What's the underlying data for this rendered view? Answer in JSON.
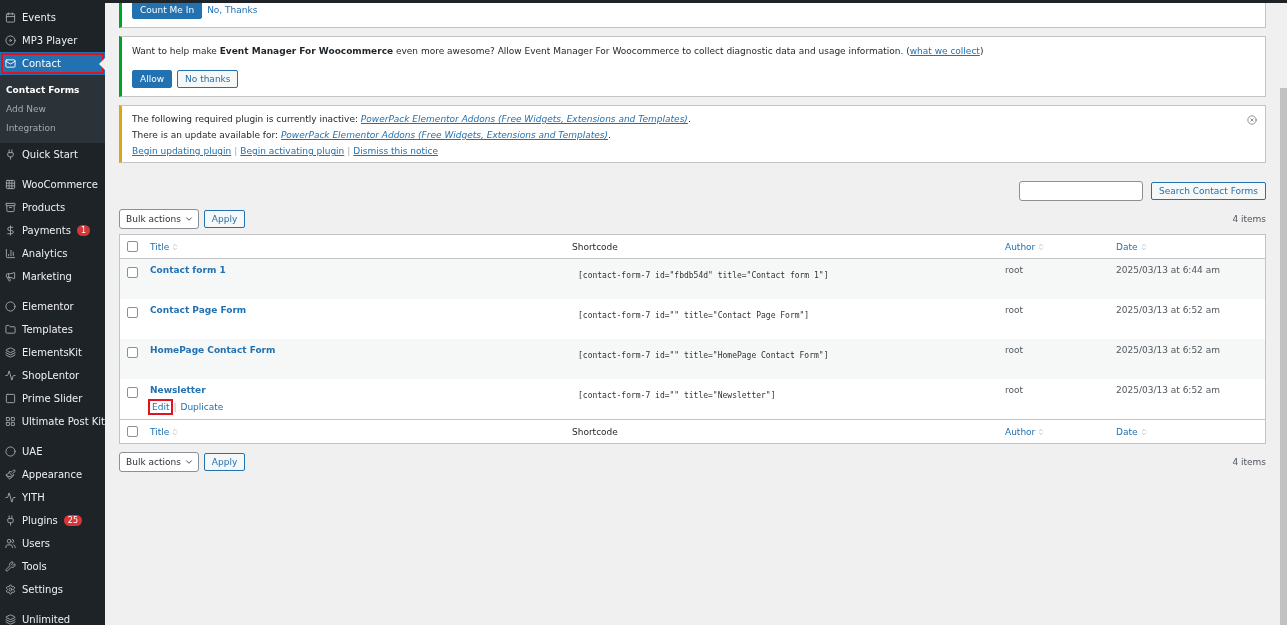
{
  "sidebar": {
    "groups": [
      [
        {
          "label": "Events",
          "selected": false,
          "highlighted": false
        },
        {
          "label": "MP3 Player",
          "selected": false,
          "highlighted": false
        },
        {
          "label": "Contact",
          "selected": true,
          "highlighted": true,
          "submenu": [
            {
              "label": "Contact Forms",
              "selected": true
            },
            {
              "label": "Add New",
              "selected": false
            },
            {
              "label": "Integration",
              "selected": false
            }
          ]
        },
        {
          "label": "Quick Start",
          "selected": false,
          "highlighted": false
        }
      ],
      [
        {
          "label": "WooCommerce",
          "selected": false,
          "highlighted": false
        },
        {
          "label": "Products",
          "selected": false,
          "highlighted": false
        },
        {
          "label": "Payments",
          "selected": false,
          "highlighted": false,
          "badge": "1"
        },
        {
          "label": "Analytics",
          "selected": false,
          "highlighted": false
        },
        {
          "label": "Marketing",
          "selected": false,
          "highlighted": false
        }
      ],
      [
        {
          "label": "Elementor",
          "selected": false,
          "highlighted": false
        },
        {
          "label": "Templates",
          "selected": false,
          "highlighted": false
        },
        {
          "label": "ElementsKit",
          "selected": false,
          "highlighted": false
        },
        {
          "label": "ShopLentor",
          "selected": false,
          "highlighted": false
        },
        {
          "label": "Prime Slider",
          "selected": false,
          "highlighted": false
        },
        {
          "label": "Ultimate Post Kit",
          "selected": false,
          "highlighted": false
        }
      ],
      [
        {
          "label": "UAE",
          "selected": false,
          "highlighted": false
        },
        {
          "label": "Appearance",
          "selected": false,
          "highlighted": false
        },
        {
          "label": "YITH",
          "selected": false,
          "highlighted": false
        },
        {
          "label": "Plugins",
          "selected": false,
          "highlighted": false,
          "badge": "25"
        },
        {
          "label": "Users",
          "selected": false,
          "highlighted": false
        },
        {
          "label": "Tools",
          "selected": false,
          "highlighted": false
        },
        {
          "label": "Settings",
          "selected": false,
          "highlighted": false
        }
      ],
      [
        {
          "label": "Unlimited",
          "selected": false,
          "highlighted": false
        }
      ]
    ]
  },
  "notices": [
    {
      "kind": "success",
      "buttons": [
        {
          "label": "Count Me In",
          "primary": true
        },
        {
          "label": "No, Thanks",
          "primary": false,
          "link": true
        }
      ]
    },
    {
      "kind": "success",
      "text": "Want to help make **Event Manager For Woocommerce** even more awesome? Allow Event Manager For Woocommerce to collect diagnostic data and usage information. (",
      "link": "what we collect",
      "text_after": ")",
      "buttons": [
        {
          "label": "Allow",
          "primary": true
        },
        {
          "label": "No thanks",
          "primary": false
        }
      ]
    },
    {
      "kind": "warning",
      "dismissible": true,
      "separator": "|",
      "lines": [
        {
          "text": "The following required plugin is currently inactive: ",
          "link": "PowerPack Elementor Addons (Free Widgets, Extensions and Templates)",
          "after": "."
        },
        {
          "text": "There is an update available for: ",
          "link": "PowerPack Elementor Addons (Free Widgets, Extensions and Templates)",
          "after": "."
        }
      ],
      "actions": [
        "Begin updating plugin",
        "Begin activating plugin",
        "Dismiss this notice"
      ]
    }
  ],
  "search": {
    "button": "Search Contact Forms"
  },
  "bulk_top": {
    "select": "Bulk actions",
    "apply": "Apply",
    "count": "4 items"
  },
  "table": {
    "header_checked": false,
    "columns": [
      {
        "label": "Title",
        "sortable": true
      },
      {
        "label": "Shortcode",
        "sortable": false
      },
      {
        "label": "Author",
        "sortable": true
      },
      {
        "label": "Date",
        "sortable": true
      }
    ],
    "footer_checked": false,
    "footer_columns": [
      {
        "label": "Title",
        "sortable": true
      },
      {
        "label": "Shortcode",
        "sortable": false
      },
      {
        "label": "Author",
        "sortable": true
      },
      {
        "label": "Date",
        "sortable": true
      }
    ],
    "rows": [
      {
        "title": "Contact form 1",
        "shortcode": "[contact-form-7 id=\"fbdb54d\" title=\"Contact form 1\"]",
        "author": "root",
        "date": "2025/03/13 at 6:44 am",
        "checked": false
      },
      {
        "title": "Contact Page Form",
        "shortcode": "[contact-form-7 id=\"\" title=\"Contact Page Form\"]",
        "author": "root",
        "date": "2025/03/13 at 6:52 am",
        "checked": false
      },
      {
        "title": "HomePage Contact Form",
        "shortcode": "[contact-form-7 id=\"\" title=\"HomePage Contact Form\"]",
        "author": "root",
        "date": "2025/03/13 at 6:52 am",
        "checked": false
      },
      {
        "title": "Newsletter",
        "shortcode": "[contact-form-7 id=\"\" title=\"Newsletter\"]",
        "author": "root",
        "date": "2025/03/13 at 6:52 am",
        "checked": false,
        "separator": "|",
        "actions": [
          {
            "label": "Edit",
            "highlighted": true
          },
          {
            "label": "Duplicate",
            "highlighted": false
          }
        ]
      }
    ]
  },
  "bulk_bottom": {
    "select": "Bulk actions",
    "apply": "Apply",
    "count": "4 items"
  }
}
